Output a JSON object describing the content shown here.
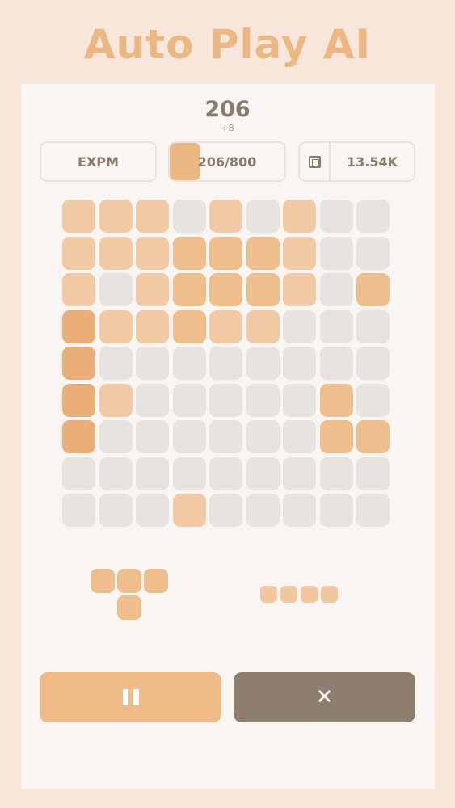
{
  "title": "Auto Play AI",
  "score": {
    "value": "206",
    "delta": "+8"
  },
  "stats": {
    "mode_label": "EXPM",
    "progress_text": "206/800",
    "progress_fraction": 0.2575,
    "coins_icon": "chip-icon",
    "coins_value": "13.54K"
  },
  "colors": {
    "empty": "#e7e3de",
    "light": "#f1c9a4",
    "medium": "#eebe8d",
    "dark": "#eaae78",
    "accent": "#ebb883",
    "close_button": "#8e7e6f",
    "background": "#f8e6da",
    "panel": "#f8f5f2"
  },
  "board": {
    "size": 9,
    "rows": [
      "LLLELELEE",
      "LLLMMMLEE",
      "LELMMMLEM",
      "DLLMLLEEE",
      "DEEEEEEEE",
      "DLEEEEEME",
      "DEEEEEEMM",
      "EEEEEEEEE",
      "EEELEEEEE"
    ]
  },
  "pieces": [
    {
      "name": "t-shape",
      "cells": [
        [
          0,
          0
        ],
        [
          0,
          1
        ],
        [
          0,
          2
        ],
        [
          1,
          1
        ]
      ]
    },
    {
      "name": "line-four",
      "cells": [
        [
          0,
          0
        ],
        [
          0,
          1
        ],
        [
          0,
          2
        ],
        [
          0,
          3
        ]
      ]
    }
  ],
  "buttons": {
    "pause_icon": "pause-icon",
    "close_icon": "close-icon",
    "close_glyph": "✕"
  }
}
